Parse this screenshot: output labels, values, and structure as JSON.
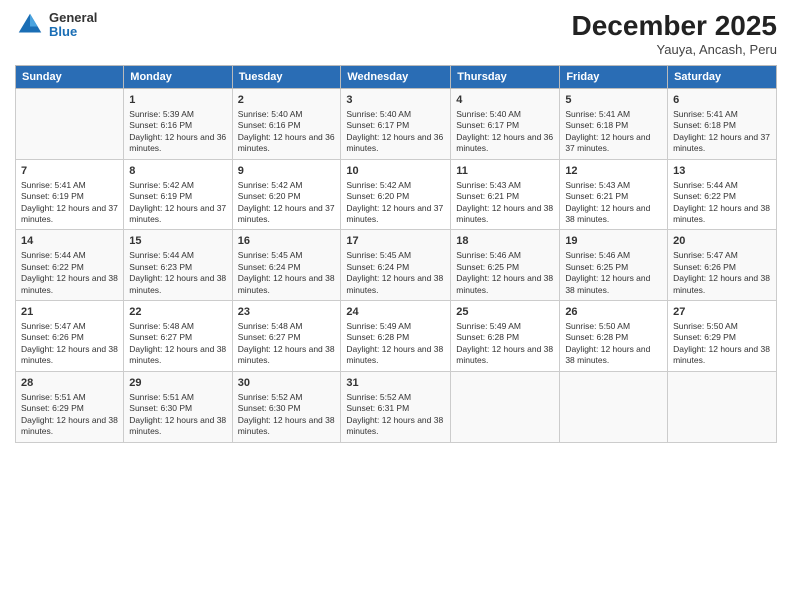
{
  "header": {
    "logo_general": "General",
    "logo_blue": "Blue",
    "month_title": "December 2025",
    "subtitle": "Yauya, Ancash, Peru"
  },
  "columns": [
    "Sunday",
    "Monday",
    "Tuesday",
    "Wednesday",
    "Thursday",
    "Friday",
    "Saturday"
  ],
  "weeks": [
    [
      {
        "day": "",
        "info": ""
      },
      {
        "day": "1",
        "info": "Sunrise: 5:39 AM\nSunset: 6:16 PM\nDaylight: 12 hours and 36 minutes."
      },
      {
        "day": "2",
        "info": "Sunrise: 5:40 AM\nSunset: 6:16 PM\nDaylight: 12 hours and 36 minutes."
      },
      {
        "day": "3",
        "info": "Sunrise: 5:40 AM\nSunset: 6:17 PM\nDaylight: 12 hours and 36 minutes."
      },
      {
        "day": "4",
        "info": "Sunrise: 5:40 AM\nSunset: 6:17 PM\nDaylight: 12 hours and 36 minutes."
      },
      {
        "day": "5",
        "info": "Sunrise: 5:41 AM\nSunset: 6:18 PM\nDaylight: 12 hours and 37 minutes."
      },
      {
        "day": "6",
        "info": "Sunrise: 5:41 AM\nSunset: 6:18 PM\nDaylight: 12 hours and 37 minutes."
      }
    ],
    [
      {
        "day": "7",
        "info": "Sunrise: 5:41 AM\nSunset: 6:19 PM\nDaylight: 12 hours and 37 minutes."
      },
      {
        "day": "8",
        "info": "Sunrise: 5:42 AM\nSunset: 6:19 PM\nDaylight: 12 hours and 37 minutes."
      },
      {
        "day": "9",
        "info": "Sunrise: 5:42 AM\nSunset: 6:20 PM\nDaylight: 12 hours and 37 minutes."
      },
      {
        "day": "10",
        "info": "Sunrise: 5:42 AM\nSunset: 6:20 PM\nDaylight: 12 hours and 37 minutes."
      },
      {
        "day": "11",
        "info": "Sunrise: 5:43 AM\nSunset: 6:21 PM\nDaylight: 12 hours and 38 minutes."
      },
      {
        "day": "12",
        "info": "Sunrise: 5:43 AM\nSunset: 6:21 PM\nDaylight: 12 hours and 38 minutes."
      },
      {
        "day": "13",
        "info": "Sunrise: 5:44 AM\nSunset: 6:22 PM\nDaylight: 12 hours and 38 minutes."
      }
    ],
    [
      {
        "day": "14",
        "info": "Sunrise: 5:44 AM\nSunset: 6:22 PM\nDaylight: 12 hours and 38 minutes."
      },
      {
        "day": "15",
        "info": "Sunrise: 5:44 AM\nSunset: 6:23 PM\nDaylight: 12 hours and 38 minutes."
      },
      {
        "day": "16",
        "info": "Sunrise: 5:45 AM\nSunset: 6:24 PM\nDaylight: 12 hours and 38 minutes."
      },
      {
        "day": "17",
        "info": "Sunrise: 5:45 AM\nSunset: 6:24 PM\nDaylight: 12 hours and 38 minutes."
      },
      {
        "day": "18",
        "info": "Sunrise: 5:46 AM\nSunset: 6:25 PM\nDaylight: 12 hours and 38 minutes."
      },
      {
        "day": "19",
        "info": "Sunrise: 5:46 AM\nSunset: 6:25 PM\nDaylight: 12 hours and 38 minutes."
      },
      {
        "day": "20",
        "info": "Sunrise: 5:47 AM\nSunset: 6:26 PM\nDaylight: 12 hours and 38 minutes."
      }
    ],
    [
      {
        "day": "21",
        "info": "Sunrise: 5:47 AM\nSunset: 6:26 PM\nDaylight: 12 hours and 38 minutes."
      },
      {
        "day": "22",
        "info": "Sunrise: 5:48 AM\nSunset: 6:27 PM\nDaylight: 12 hours and 38 minutes."
      },
      {
        "day": "23",
        "info": "Sunrise: 5:48 AM\nSunset: 6:27 PM\nDaylight: 12 hours and 38 minutes."
      },
      {
        "day": "24",
        "info": "Sunrise: 5:49 AM\nSunset: 6:28 PM\nDaylight: 12 hours and 38 minutes."
      },
      {
        "day": "25",
        "info": "Sunrise: 5:49 AM\nSunset: 6:28 PM\nDaylight: 12 hours and 38 minutes."
      },
      {
        "day": "26",
        "info": "Sunrise: 5:50 AM\nSunset: 6:28 PM\nDaylight: 12 hours and 38 minutes."
      },
      {
        "day": "27",
        "info": "Sunrise: 5:50 AM\nSunset: 6:29 PM\nDaylight: 12 hours and 38 minutes."
      }
    ],
    [
      {
        "day": "28",
        "info": "Sunrise: 5:51 AM\nSunset: 6:29 PM\nDaylight: 12 hours and 38 minutes."
      },
      {
        "day": "29",
        "info": "Sunrise: 5:51 AM\nSunset: 6:30 PM\nDaylight: 12 hours and 38 minutes."
      },
      {
        "day": "30",
        "info": "Sunrise: 5:52 AM\nSunset: 6:30 PM\nDaylight: 12 hours and 38 minutes."
      },
      {
        "day": "31",
        "info": "Sunrise: 5:52 AM\nSunset: 6:31 PM\nDaylight: 12 hours and 38 minutes."
      },
      {
        "day": "",
        "info": ""
      },
      {
        "day": "",
        "info": ""
      },
      {
        "day": "",
        "info": ""
      }
    ]
  ]
}
